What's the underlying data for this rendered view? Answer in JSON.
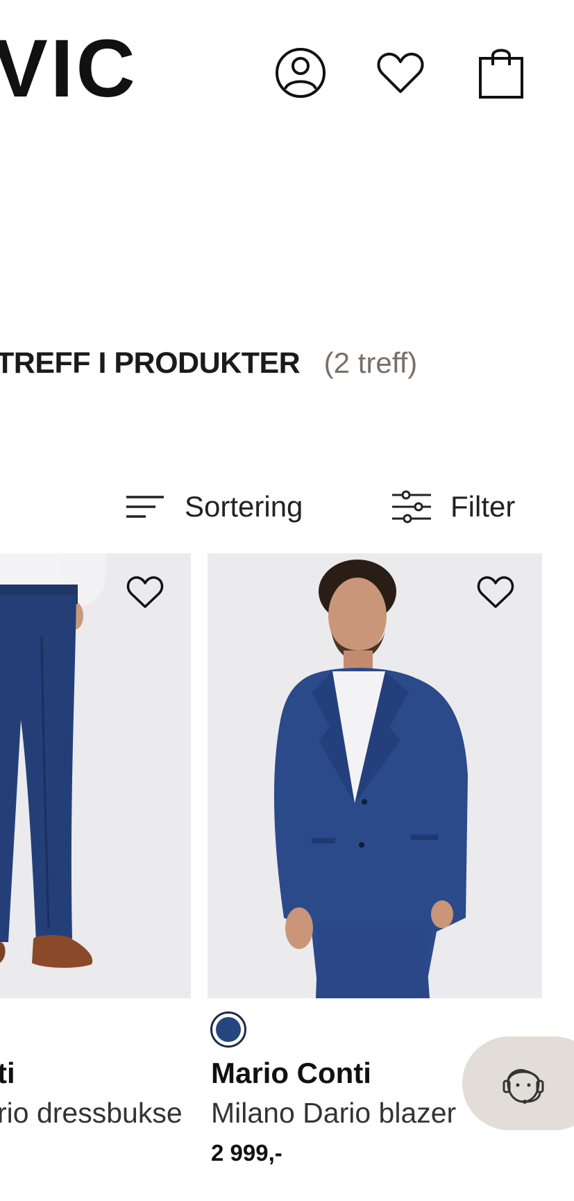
{
  "header": {
    "logo_text": "VIC",
    "icons": [
      "account-icon",
      "heart-icon",
      "shopping-bag-icon"
    ]
  },
  "results": {
    "title": "TREFF I PRODUKTER",
    "count": "(2 treff)"
  },
  "toolbar": {
    "sort_label": "Sortering",
    "filter_label": "Filter"
  },
  "products": [
    {
      "brand": "ti",
      "name": "rio dressbukse"
    },
    {
      "brand": "Mario Conti",
      "name": "Milano Dario blazer",
      "price": "2 999,-",
      "color_swatch": "#25477d"
    }
  ],
  "support_icon": "customer-support-icon",
  "colors": {
    "accent_text": "#7a6f66",
    "support_bg": "#e2ddd6",
    "suit_blue": "#25477d"
  }
}
